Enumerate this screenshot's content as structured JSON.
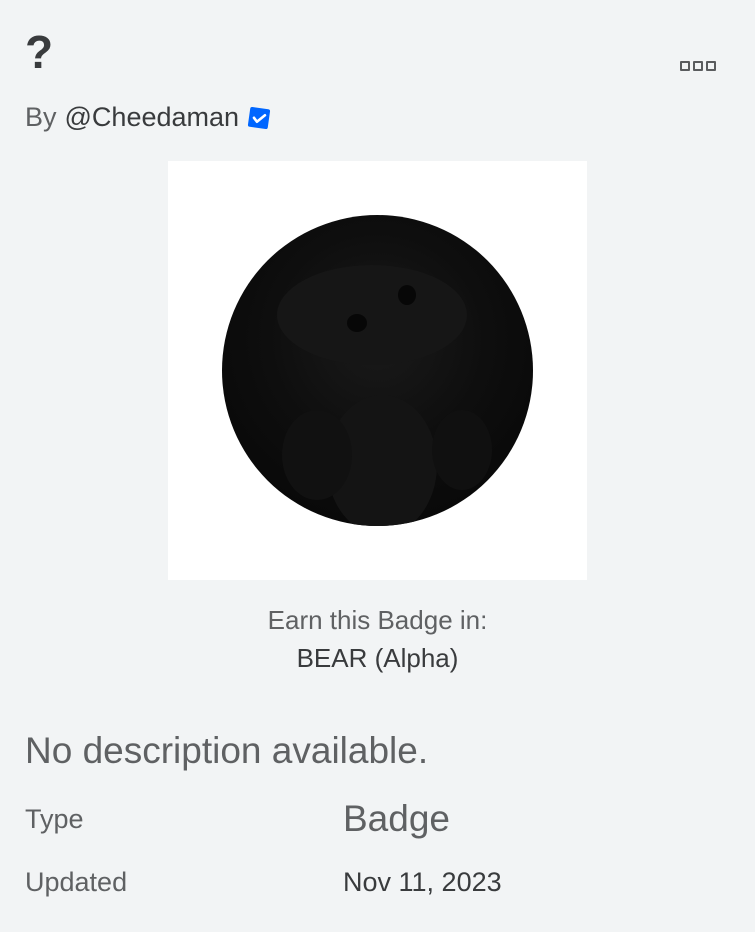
{
  "badge": {
    "name": "?",
    "by_label": "By",
    "creator": "@Cheedaman",
    "verified_icon": "verified-check-icon",
    "more_icon": "more-options-icon"
  },
  "earn": {
    "label": "Earn this Badge in:",
    "game": "BEAR (Alpha)"
  },
  "description": "No description available.",
  "details": {
    "type_label": "Type",
    "type_value": "Badge",
    "updated_label": "Updated",
    "updated_value": "Nov 11, 2023"
  },
  "colors": {
    "background": "#f2f4f5",
    "verified": "#0066ff"
  }
}
